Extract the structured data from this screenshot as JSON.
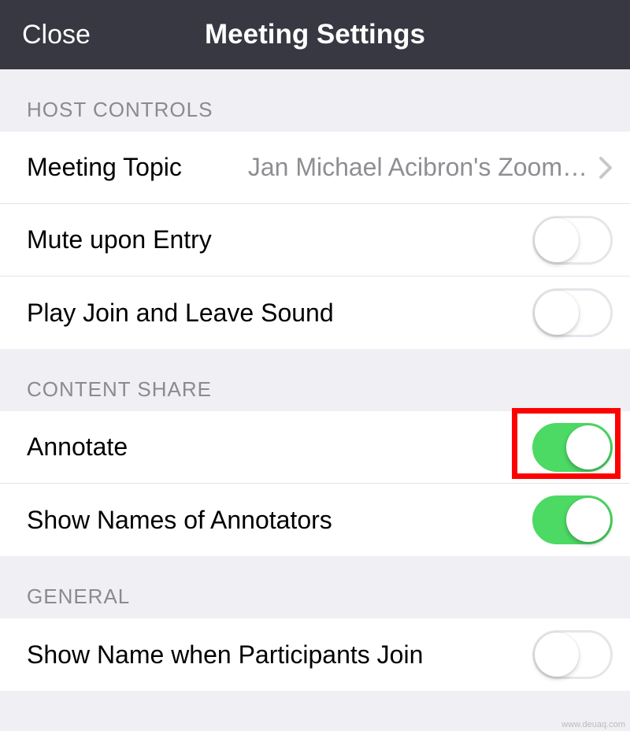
{
  "navbar": {
    "close_label": "Close",
    "title": "Meeting Settings"
  },
  "sections": {
    "host_controls": {
      "header": "HOST CONTROLS",
      "meeting_topic": {
        "label": "Meeting Topic",
        "value": "Jan Michael Acibron's Zoom…"
      },
      "mute_upon_entry": {
        "label": "Mute upon Entry",
        "on": false
      },
      "play_join_leave": {
        "label": "Play Join and Leave Sound",
        "on": false
      }
    },
    "content_share": {
      "header": "CONTENT SHARE",
      "annotate": {
        "label": "Annotate",
        "on": true
      },
      "show_annotators": {
        "label": "Show Names of Annotators",
        "on": true
      }
    },
    "general": {
      "header": "GENERAL",
      "show_name_join": {
        "label": "Show Name when Participants Join",
        "on": false
      }
    }
  },
  "watermark": "www.deuaq.com"
}
